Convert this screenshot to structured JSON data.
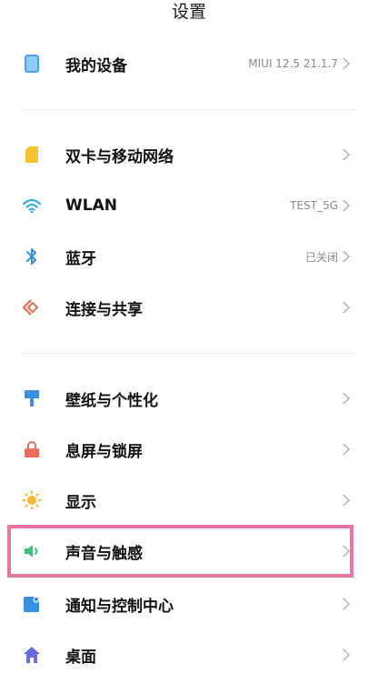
{
  "header": {
    "title": "设置"
  },
  "groups": [
    {
      "items": [
        {
          "id": "my-device",
          "label": "我的设备",
          "value": "MIUI 12.5 21.1.7",
          "icon": "phone-device-icon",
          "color": "#4aa3ec"
        }
      ]
    },
    {
      "items": [
        {
          "id": "sim-network",
          "label": "双卡与移动网络",
          "value": "",
          "icon": "sim-card-icon",
          "color": "#f5c230"
        },
        {
          "id": "wlan",
          "label": "WLAN",
          "value": "TEST_5G",
          "icon": "wifi-icon",
          "color": "#3aa8e0"
        },
        {
          "id": "bluetooth",
          "label": "蓝牙",
          "value": "已关闭",
          "icon": "bluetooth-icon",
          "color": "#3a8fe0"
        },
        {
          "id": "connection-sharing",
          "label": "连接与共享",
          "value": "",
          "icon": "connection-share-icon",
          "color": "#e07a5a"
        }
      ]
    },
    {
      "items": [
        {
          "id": "wallpaper",
          "label": "壁纸与个性化",
          "value": "",
          "icon": "paint-brush-icon",
          "color": "#3a8fe0"
        },
        {
          "id": "lock-screen",
          "label": "息屏与锁屏",
          "value": "",
          "icon": "lock-icon",
          "color": "#f06a5a"
        },
        {
          "id": "display",
          "label": "显示",
          "value": "",
          "icon": "sun-icon",
          "color": "#f5b730"
        },
        {
          "id": "sound",
          "label": "声音与触感",
          "value": "",
          "icon": "speaker-icon",
          "color": "#3cc47a"
        },
        {
          "id": "notification",
          "label": "通知与控制中心",
          "value": "",
          "icon": "notification-icon",
          "color": "#3a8fe0"
        },
        {
          "id": "home-screen",
          "label": "桌面",
          "value": "",
          "icon": "home-icon",
          "color": "#6a6ae0"
        }
      ]
    }
  ],
  "highlight": {
    "color": "#e8769e",
    "target": "sound"
  }
}
